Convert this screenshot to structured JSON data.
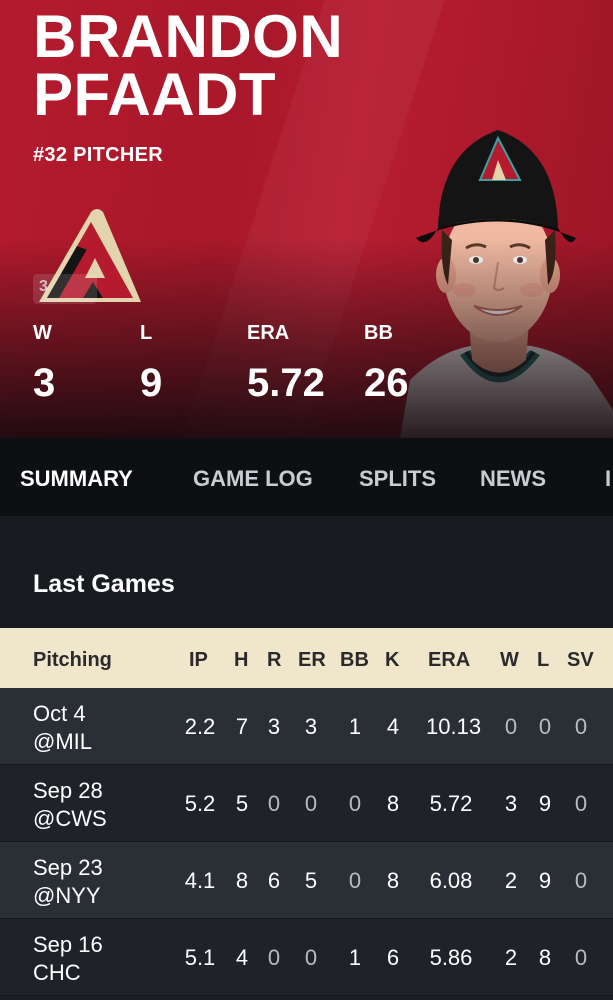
{
  "player": {
    "first_name": "BRANDON",
    "last_name": "PFAADT",
    "subtitle": "#32 PITCHER",
    "badge_text": "3",
    "stats": [
      {
        "label": "W",
        "value": "3"
      },
      {
        "label": "L",
        "value": "9"
      },
      {
        "label": "ERA",
        "value": "5.72"
      },
      {
        "label": "BB",
        "value": "26"
      }
    ]
  },
  "colors": {
    "team_red": "#b51a2e",
    "team_sand": "#e3d4ad",
    "header_bg": "#efe6cc"
  },
  "tabs": [
    "SUMMARY",
    "GAME LOG",
    "SPLITS",
    "NEWS",
    "I"
  ],
  "section": {
    "title": "Last Games"
  },
  "table": {
    "columns": [
      "Pitching",
      "IP",
      "H",
      "R",
      "ER",
      "BB",
      "K",
      "ERA",
      "W",
      "L",
      "SV"
    ],
    "rows": [
      {
        "date": "Oct 4",
        "opp": "@MIL",
        "ip": "2.2",
        "h": "7",
        "r": "3",
        "er": "3",
        "bb": "1",
        "k": "4",
        "era": "10.13",
        "w": "0",
        "l": "0",
        "sv": "0"
      },
      {
        "date": "Sep 28",
        "opp": "@CWS",
        "ip": "5.2",
        "h": "5",
        "r": "0",
        "er": "0",
        "bb": "0",
        "k": "8",
        "era": "5.72",
        "w": "3",
        "l": "9",
        "sv": "0"
      },
      {
        "date": "Sep 23",
        "opp": "@NYY",
        "ip": "4.1",
        "h": "8",
        "r": "6",
        "er": "5",
        "bb": "0",
        "k": "8",
        "era": "6.08",
        "w": "2",
        "l": "9",
        "sv": "0"
      },
      {
        "date": "Sep 16",
        "opp": "CHC",
        "ip": "5.1",
        "h": "4",
        "r": "0",
        "er": "0",
        "bb": "1",
        "k": "6",
        "era": "5.86",
        "w": "2",
        "l": "8",
        "sv": "0"
      }
    ]
  }
}
